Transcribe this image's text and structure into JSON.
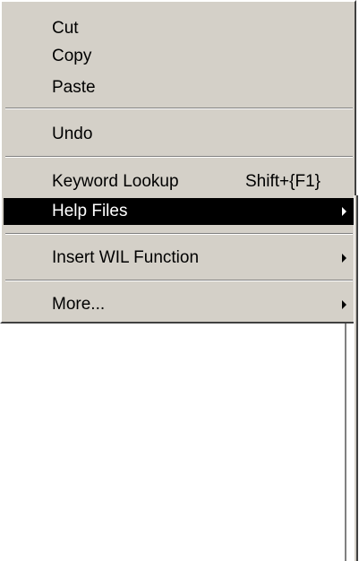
{
  "context_menu": {
    "items": [
      {
        "label": "Cut"
      },
      {
        "label": "Copy"
      },
      {
        "label": "Paste"
      },
      {
        "label": "Undo"
      },
      {
        "label": "Keyword Lookup",
        "shortcut": "Shift+{F1}"
      },
      {
        "label": "Help Files",
        "has_submenu": true,
        "highlighted": true
      },
      {
        "label": "Insert WIL Function",
        "has_submenu": true
      },
      {
        "label": "More...",
        "has_submenu": true
      }
    ]
  },
  "colors": {
    "menu_background": "#d4d0c8",
    "highlight_background": "#000000",
    "highlight_text": "#ffffff",
    "text": "#000000"
  },
  "icons": {
    "submenu_arrow": "triangle-right-icon"
  }
}
